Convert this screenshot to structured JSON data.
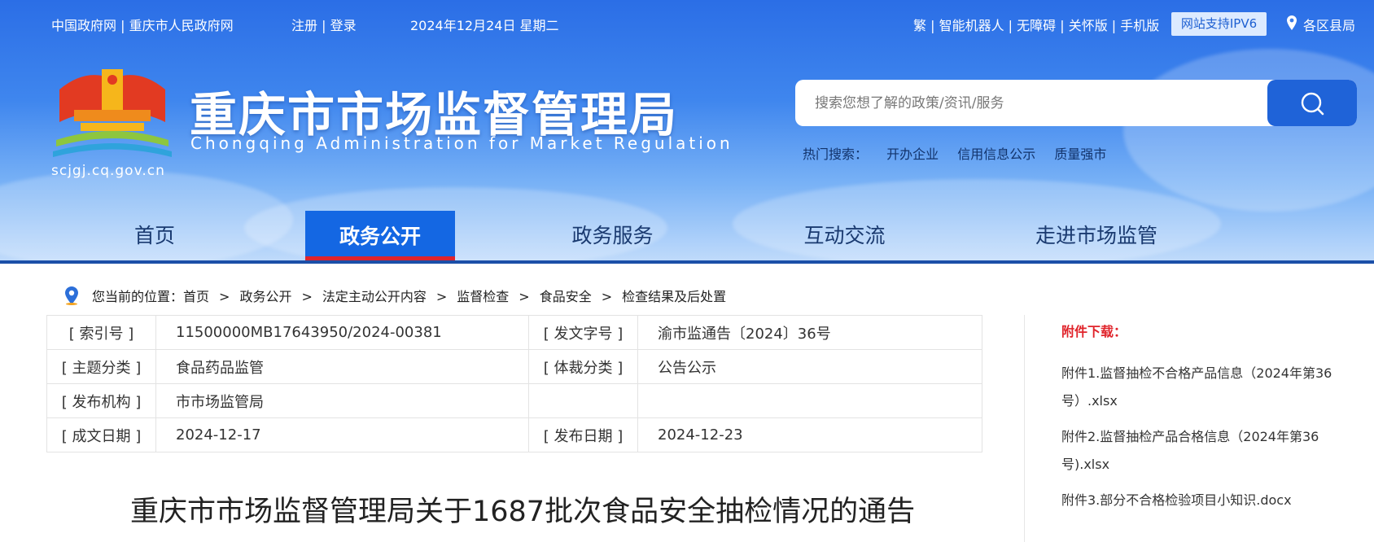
{
  "topbar": {
    "links_left": "中国政府网 | 重庆市人民政府网",
    "auth": "注册 | 登录",
    "date": "2024年12月24日 星期二",
    "links_right": "繁 | 智能机器人 | 无障碍 | 关怀版 | 手机版",
    "ipv6": "网站支持IPV6",
    "districts": "各区县局"
  },
  "brand": {
    "title": "重庆市市场监督管理局",
    "subtitle": "Chongqing Administration for Market Regulation",
    "domain": "scjgj.cq.gov.cn"
  },
  "search": {
    "placeholder": "搜索您想了解的政策/资讯/服务",
    "hot_label": "热门搜索：",
    "hot_terms": [
      "开办企业",
      "信用信息公示",
      "质量强市"
    ]
  },
  "nav": {
    "items": [
      "首页",
      "政务公开",
      "政务服务",
      "互动交流",
      "走进市场监管"
    ],
    "active": "政务公开"
  },
  "breadcrumb": {
    "prefix": "您当前的位置：",
    "items": [
      "首页",
      "政务公开",
      "法定主动公开内容",
      "监督检查",
      "食品安全",
      "检查结果及后处置"
    ],
    "separator": ">"
  },
  "meta": {
    "rows": [
      {
        "k1": "[ 索引号 ]",
        "v1": "11500000MB17643950/2024-00381",
        "k2": "[ 发文字号 ]",
        "v2": "渝市监通告〔2024〕36号"
      },
      {
        "k1": "[ 主题分类 ]",
        "v1": "食品药品监管",
        "k2": "[ 体裁分类 ]",
        "v2": "公告公示"
      },
      {
        "k1": "[ 发布机构 ]",
        "v1": "市市场监管局",
        "k2": "",
        "v2": ""
      },
      {
        "k1": "[ 成文日期 ]",
        "v1": "2024-12-17",
        "k2": "[ 发布日期 ]",
        "v2": "2024-12-23"
      }
    ]
  },
  "document": {
    "title": "重庆市市场监督管理局关于1687批次食品安全抽检情况的通告"
  },
  "attachments": {
    "title": "附件下载：",
    "items": [
      "附件1.监督抽检不合格产品信息（2024年第36号）.xlsx",
      "附件2.监督抽检产品合格信息（2024年第36号).xlsx",
      "附件3.部分不合格检验项目小知识.docx"
    ]
  },
  "colors": {
    "header_blue": "#2b6ee6",
    "nav_active": "#1467e3",
    "nav_accent_red": "#e0242b",
    "attachment_title": "#e0242b"
  },
  "icons": [
    "location-pin-icon",
    "search-icon",
    "emblem-logo",
    "breadcrumb-location-icon"
  ]
}
